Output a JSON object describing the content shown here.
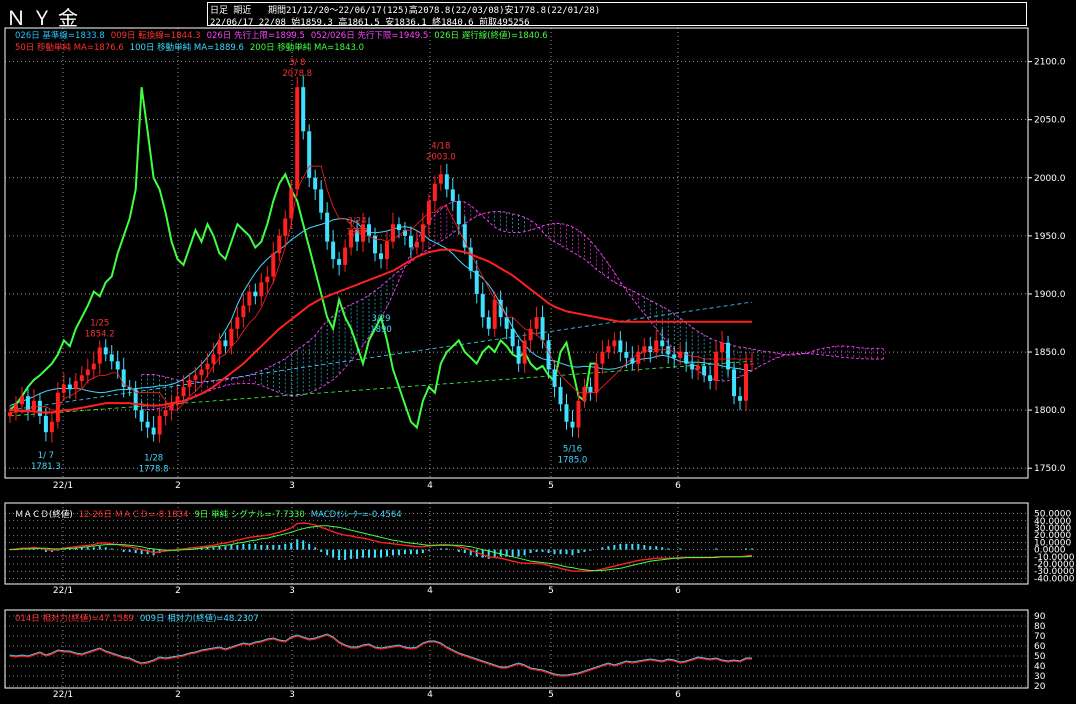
{
  "header": {
    "title": "ＮＹ金",
    "line1_left": "日足 期近",
    "line1_right": "期間21/12/20～22/06/17(125)高2078.8(22/03/08)安1778.8(22/01/28)",
    "line2": "22/06/17 22/08 始1859.3 高1861.5 安1836.1 終1840.6 前取495256"
  },
  "legend": {
    "row1": [
      {
        "text": "026日 基準線=1833.8",
        "color": "#22c0ff"
      },
      {
        "text": "009日 転換線=1844.3",
        "color": "#ff3030"
      },
      {
        "text": "026日 先行上限=1899.5",
        "color": "#ff40ff"
      },
      {
        "text": "052/026日 先行下限=1949.5",
        "color": "#ff40ff"
      },
      {
        "text": "026日 遅行線(終値)=1840.6",
        "color": "#40ff40"
      }
    ],
    "row2": [
      {
        "text": "50日 移動単純 MA=1876.6",
        "color": "#ff3030"
      },
      {
        "text": "100日 移動単純 MA=1889.6",
        "color": "#40d8ff"
      },
      {
        "text": "200日 移動単純 MA=1843.0",
        "color": "#40ff40"
      }
    ],
    "macd": [
      {
        "text": "ＭＡＣＤ(終値)",
        "color": "#ffffff"
      },
      {
        "text": "12-26日 ＭＡＣＤ=-8.1834",
        "color": "#ff3030"
      },
      {
        "text": "9日 単純 シグナル=-7.7330",
        "color": "#40ff40"
      },
      {
        "text": "MACDｵｼﾚｰﾀｰ=-0.4564",
        "color": "#40d8ff"
      }
    ],
    "rsi": [
      {
        "text": "014日 相対力(終値)=47.1589",
        "color": "#ff3030"
      },
      {
        "text": "009日 相対力(終値)=48.2307",
        "color": "#40d8ff"
      }
    ]
  },
  "colors": {
    "up": "#ff2020",
    "down": "#40e0ff",
    "grid": "#ffffff",
    "ma50": "#ff2020",
    "ma100": "#40d8ff",
    "ma200": "#40ff40",
    "chikou": "#40ff40",
    "kumo_a": "#ff40ff",
    "kumo_b": "#40e0ff"
  },
  "chart_data": [
    {
      "type": "candlestick",
      "title": "ＮＹ金",
      "y_ticks": [
        2100,
        2050,
        2000,
        1950,
        1900,
        1850,
        1800,
        1750
      ],
      "ylim": [
        1745,
        2110
      ],
      "x_ticks": [
        "22/1",
        "2",
        "3",
        "4",
        "5",
        "6"
      ],
      "annotations": [
        {
          "date": "3/ 8",
          "value": "2078.8"
        },
        {
          "date": "1/25",
          "value": "1854.2"
        },
        {
          "date": "3/24",
          "value": "1987"
        },
        {
          "date": "4/18",
          "value": "2003.0"
        },
        {
          "date": "3/29",
          "value": "1890"
        },
        {
          "date": "1/ 7",
          "value": "1781.3"
        },
        {
          "date": "1/28",
          "value": "1778.8"
        },
        {
          "date": "5/16",
          "value": "1785.0"
        }
      ],
      "closes": [
        1798,
        1805,
        1812,
        1800,
        1808,
        1795,
        1781,
        1790,
        1815,
        1822,
        1818,
        1825,
        1830,
        1835,
        1840,
        1854,
        1848,
        1842,
        1835,
        1820,
        1818,
        1800,
        1790,
        1785,
        1779,
        1795,
        1800,
        1805,
        1812,
        1820,
        1826,
        1830,
        1835,
        1840,
        1848,
        1860,
        1855,
        1870,
        1880,
        1890,
        1902,
        1898,
        1910,
        1915,
        1935,
        1950,
        1965,
        1990,
        2078,
        2040,
        2000,
        1990,
        1970,
        1945,
        1930,
        1925,
        1940,
        1955,
        1945,
        1960,
        1950,
        1935,
        1930,
        1945,
        1960,
        1955,
        1950,
        1940,
        1945,
        1960,
        1980,
        1995,
        2003,
        1990,
        1980,
        1960,
        1940,
        1920,
        1900,
        1880,
        1870,
        1895,
        1880,
        1870,
        1855,
        1840,
        1860,
        1870,
        1880,
        1860,
        1835,
        1820,
        1805,
        1790,
        1785,
        1808,
        1820,
        1815,
        1840,
        1850,
        1855,
        1860,
        1850,
        1845,
        1840,
        1850,
        1855,
        1850,
        1860,
        1855,
        1848,
        1845,
        1850,
        1840,
        1835,
        1838,
        1830,
        1825,
        1850,
        1858,
        1835,
        1812,
        1808,
        1840,
        1840
      ],
      "series": [
        {
          "name": "50日 移動単純",
          "values": [
            1800,
            1800,
            1799,
            1799,
            1799,
            1798,
            1798,
            1798,
            1799,
            1800,
            1800,
            1801,
            1802,
            1803,
            1804,
            1805,
            1806,
            1806,
            1806,
            1806,
            1806,
            1805,
            1805,
            1804,
            1804,
            1804,
            1805,
            1806,
            1807,
            1808,
            1810,
            1812,
            1814,
            1817,
            1820,
            1824,
            1828,
            1832,
            1836,
            1840,
            1845,
            1850,
            1855,
            1860,
            1865,
            1870,
            1874,
            1878,
            1882,
            1886,
            1890,
            1893,
            1896,
            1898,
            1900,
            1902,
            1904,
            1906,
            1908,
            1910,
            1912,
            1914,
            1916,
            1918,
            1920,
            1923,
            1926,
            1929,
            1932,
            1934,
            1936,
            1937,
            1938,
            1938,
            1938,
            1937,
            1936,
            1934,
            1932,
            1930,
            1928,
            1925,
            1922,
            1919,
            1916,
            1912,
            1908,
            1904,
            1900,
            1896,
            1892,
            1889,
            1887,
            1885,
            1884,
            1883,
            1882,
            1881,
            1880,
            1879,
            1878,
            1877,
            1876,
            1876,
            1876,
            1876,
            1876,
            1876,
            1876,
            1876,
            1876,
            1876,
            1876,
            1876,
            1876,
            1876,
            1876,
            1876,
            1876,
            1876,
            1876,
            1876,
            1876,
            1876,
            1876
          ]
        },
        {
          "name": "転換線",
          "values": [
            1798,
            1798,
            1800,
            1800,
            1803,
            1803,
            1803,
            1800,
            1800,
            1810,
            1812,
            1815,
            1818,
            1825,
            1828,
            1830,
            1830,
            1832,
            1832,
            1822,
            1820,
            1815,
            1815,
            1815,
            1815,
            1815,
            1808,
            1800,
            1800,
            1806,
            1812,
            1816,
            1822,
            1830,
            1838,
            1845,
            1848,
            1855,
            1860,
            1868,
            1875,
            1880,
            1888,
            1900,
            1910,
            1925,
            1940,
            1960,
            1990,
            2000,
            2010,
            2010,
            2010,
            1990,
            1975,
            1965,
            1965,
            1960,
            1955,
            1950,
            1950,
            1947,
            1947,
            1945,
            1948,
            1950,
            1955,
            1955,
            1960,
            1965,
            1970,
            1970,
            1975,
            1975,
            1965,
            1955,
            1945,
            1935,
            1925,
            1915,
            1905,
            1895,
            1890,
            1880,
            1880,
            1875,
            1870,
            1868,
            1865,
            1860,
            1850,
            1840,
            1830,
            1825,
            1820,
            1815,
            1815,
            1815,
            1815,
            1820,
            1825,
            1830,
            1835,
            1840,
            1845,
            1848,
            1850,
            1852,
            1852,
            1852,
            1852,
            1850,
            1850,
            1848,
            1846,
            1846,
            1844,
            1844,
            1844,
            1844,
            1844,
            1844,
            1844,
            1844,
            1844
          ]
        }
      ]
    },
    {
      "type": "line",
      "title": "ＭＡＣＤ(終値)",
      "y_ticks": [
        "50.0000",
        "40.0000",
        "30.0000",
        "20.0000",
        "10.0000",
        "0.0000",
        "-10.0000",
        "-20.0000",
        "-30.0000",
        "-40.0000"
      ],
      "x_ticks": [
        "22/1",
        "2",
        "3",
        "4",
        "5",
        "6"
      ],
      "series": [
        {
          "name": "12-26日 ＭＡＣＤ",
          "values": [
            0,
            1,
            2,
            2,
            3,
            2,
            0,
            -1,
            0,
            2,
            3,
            4,
            5,
            6,
            7,
            9,
            9,
            8,
            7,
            5,
            4,
            2,
            0,
            -2,
            -4,
            -3,
            -2,
            -1,
            0,
            1,
            2,
            3,
            4,
            5,
            6,
            8,
            9,
            11,
            13,
            15,
            17,
            18,
            19,
            20,
            22,
            24,
            27,
            30,
            36,
            37,
            36,
            34,
            31,
            28,
            25,
            22,
            20,
            19,
            17,
            16,
            14,
            12,
            10,
            9,
            8,
            7,
            6,
            5,
            4,
            4,
            5,
            6,
            7,
            7,
            6,
            4,
            2,
            -1,
            -4,
            -7,
            -10,
            -11,
            -12,
            -14,
            -16,
            -18,
            -19,
            -19,
            -19,
            -20,
            -22,
            -24,
            -26,
            -28,
            -30,
            -30,
            -30,
            -30,
            -29,
            -27,
            -25,
            -23,
            -21,
            -19,
            -17,
            -15,
            -14,
            -13,
            -12,
            -12,
            -12,
            -12,
            -11,
            -11,
            -11,
            -11,
            -11,
            -11,
            -10,
            -10,
            -10,
            -10,
            -10,
            -9,
            -8
          ]
        },
        {
          "name": "9日 単純 シグナル",
          "values": [
            0,
            0,
            1,
            1,
            1,
            2,
            2,
            1,
            1,
            1,
            2,
            2,
            3,
            4,
            5,
            6,
            7,
            7,
            7,
            7,
            6,
            5,
            4,
            2,
            1,
            0,
            -1,
            -1,
            -1,
            0,
            0,
            1,
            2,
            3,
            4,
            5,
            6,
            7,
            9,
            10,
            12,
            13,
            15,
            16,
            18,
            20,
            22,
            24,
            27,
            29,
            31,
            32,
            33,
            33,
            32,
            31,
            29,
            27,
            25,
            23,
            21,
            19,
            17,
            15,
            13,
            12,
            10,
            9,
            8,
            7,
            6,
            6,
            6,
            6,
            6,
            6,
            5,
            4,
            2,
            0,
            -2,
            -4,
            -6,
            -8,
            -10,
            -12,
            -14,
            -16,
            -17,
            -18,
            -19,
            -20,
            -22,
            -24,
            -25,
            -27,
            -28,
            -29,
            -29,
            -29,
            -28,
            -27,
            -26,
            -24,
            -22,
            -20,
            -18,
            -16,
            -15,
            -14,
            -13,
            -12,
            -12,
            -11,
            -11,
            -11,
            -11,
            -11,
            -11,
            -10,
            -10,
            -10,
            -10,
            -10,
            -9
          ]
        }
      ]
    },
    {
      "type": "line",
      "title": "相対力(終値)",
      "y_ticks": [
        90,
        80,
        70,
        60,
        50,
        40,
        30,
        20
      ],
      "x_ticks": [
        "22/1",
        "2",
        "3",
        "4",
        "5",
        "6"
      ],
      "series": [
        {
          "name": "014日 相対力(終値)",
          "values": [
            50,
            49,
            50,
            49,
            51,
            53,
            50,
            52,
            55,
            54,
            54,
            52,
            51,
            53,
            55,
            57,
            54,
            52,
            50,
            48,
            47,
            44,
            42,
            43,
            45,
            48,
            47,
            48,
            49,
            50,
            52,
            53,
            55,
            56,
            57,
            58,
            56,
            58,
            60,
            62,
            61,
            63,
            64,
            66,
            67,
            65,
            64,
            68,
            70,
            68,
            66,
            67,
            69,
            71,
            68,
            63,
            60,
            58,
            58,
            60,
            61,
            58,
            57,
            58,
            59,
            60,
            58,
            57,
            58,
            62,
            64,
            64,
            62,
            58,
            55,
            52,
            50,
            48,
            46,
            44,
            42,
            40,
            38,
            38,
            40,
            42,
            40,
            37,
            36,
            35,
            33,
            31,
            30,
            30,
            31,
            32,
            34,
            36,
            38,
            40,
            42,
            40,
            42,
            44,
            43,
            44,
            45,
            46,
            45,
            44,
            46,
            45,
            43,
            44,
            46,
            48,
            47,
            46,
            47,
            45,
            44,
            45,
            44,
            47,
            47
          ]
        }
      ]
    }
  ]
}
